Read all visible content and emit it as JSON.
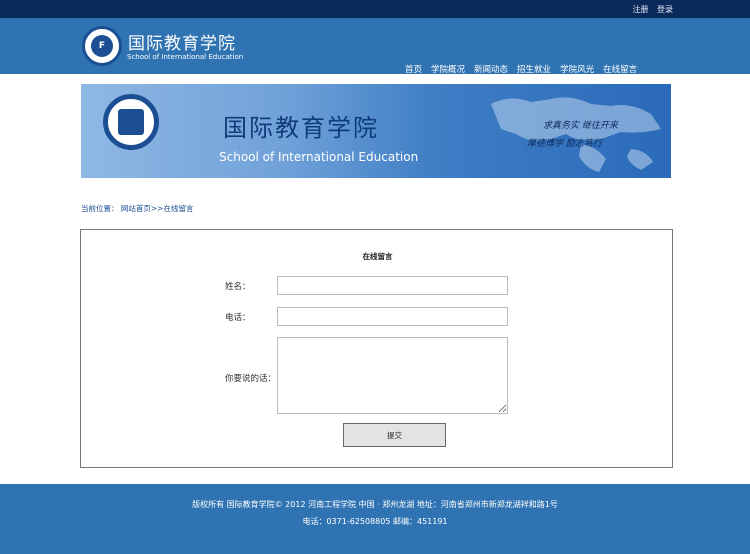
{
  "top": {
    "register": "注册",
    "login": "登录"
  },
  "header": {
    "name_cn": "国际教育学院",
    "name_en": "School of International Education",
    "nav": [
      "首页",
      "学院概况",
      "新闻动态",
      "招生就业",
      "学院风光",
      "在线留言"
    ]
  },
  "banner": {
    "name_cn": "国际教育学院",
    "name_en": "School of International Education",
    "motto_line1": "求真务实 继往开来",
    "motto_line2": "厚德博学 励志笃行"
  },
  "breadcrumb": {
    "prefix": "当前位置：",
    "home": "网站首页",
    "sep": ">>",
    "current": "在线留言"
  },
  "form": {
    "title": "在线留言",
    "name_label": "姓名：",
    "phone_label": "电话：",
    "message_label": "你要说的话：",
    "submit_label": "提交",
    "name_value": "",
    "phone_value": "",
    "message_value": ""
  },
  "footer": {
    "line1": "版权所有 国际教育学院© 2012 河南工程学院 中国 · 郑州龙湖 地址：河南省郑州市新郑龙湖祥和路1号",
    "line2": "电话：0371-62508805 邮编：451191"
  }
}
